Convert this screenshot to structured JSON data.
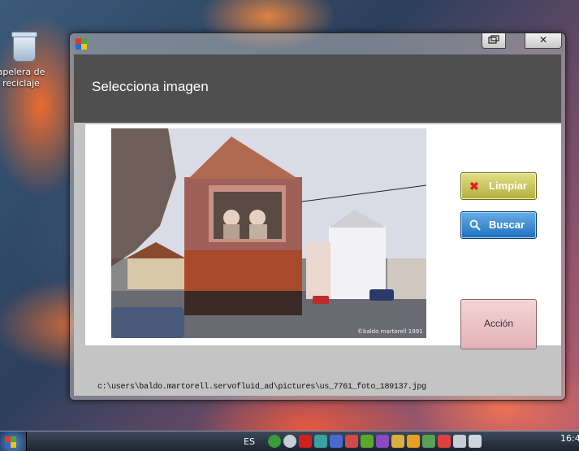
{
  "desktop": {
    "recycle_bin_label_line1": "apelera de",
    "recycle_bin_label_line2": "reciclaje"
  },
  "window": {
    "controls": {
      "restore_icon": "restore-icon",
      "close_glyph": "✕"
    },
    "header_title": "Selecciona imagen",
    "buttons": {
      "limpiar_label": "Limpiar",
      "buscar_label": "Buscar",
      "accion_label": "Acción"
    },
    "file_path": "c:\\users\\baldo.martorell.servofluid_ad\\pictures\\us_7761_foto_189137.jpg",
    "photo_watermark": "©baldo martorell 1991"
  },
  "taskbar": {
    "language": "ES",
    "clock": "16:4"
  },
  "colors": {
    "header_bg": "#4f4f4f",
    "limpiar_bg": "#cfca5c",
    "buscar_bg": "#3d8fd6",
    "accion_bg": "#ecc4c6"
  }
}
